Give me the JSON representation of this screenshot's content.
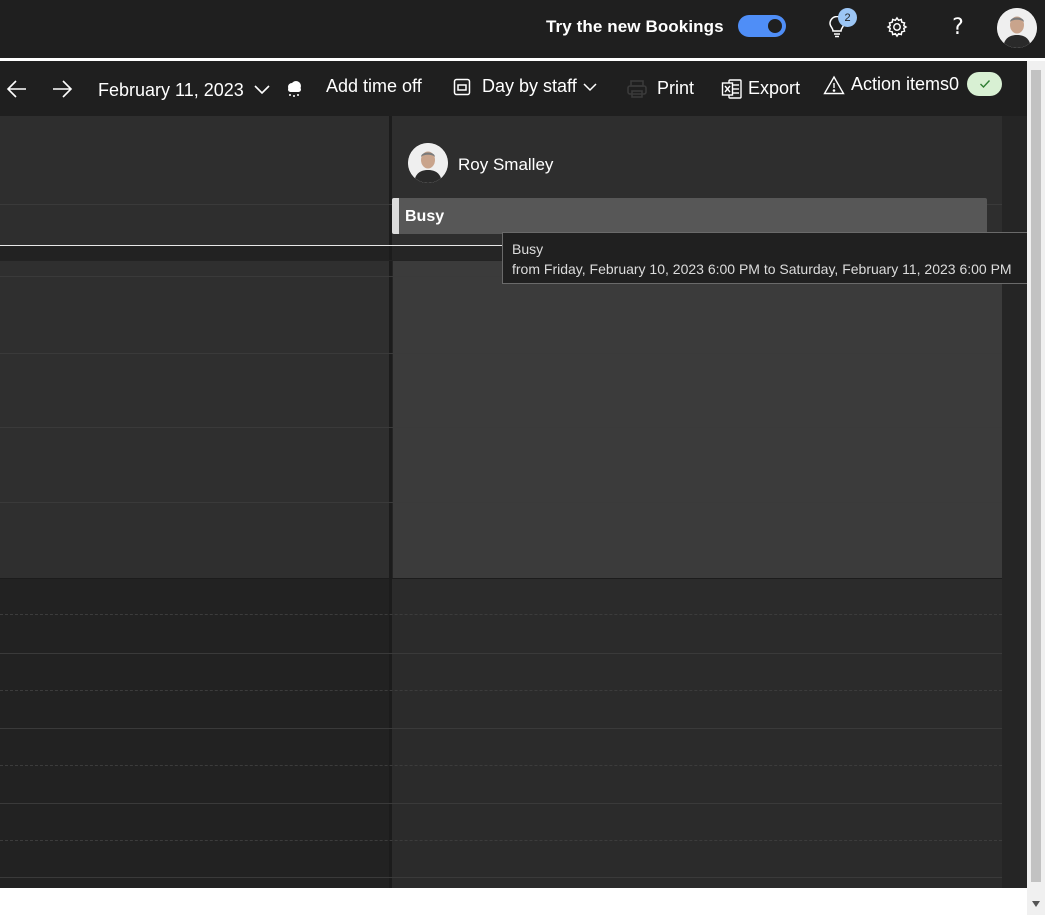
{
  "topbar": {
    "try_new_label": "Try the new Bookings",
    "toggle_on": true,
    "notifications_count": "2",
    "help_label": "?"
  },
  "toolbar": {
    "date": "February 11, 2023",
    "add_time_off": "Add time off",
    "view_mode": "Day by staff",
    "print": "Print",
    "export": "Export",
    "action_items": "Action items0"
  },
  "calendar": {
    "staff_name": "Roy Smalley",
    "event_label": "Busy"
  },
  "tooltip": {
    "title": "Busy",
    "detail": "from Friday, February 10, 2023 6:00 PM to Saturday, February 11, 2023 6:00 PM"
  },
  "colors": {
    "accent": "#4f8ef7",
    "background": "#1f1f1f",
    "success": "#d8f0d3"
  }
}
